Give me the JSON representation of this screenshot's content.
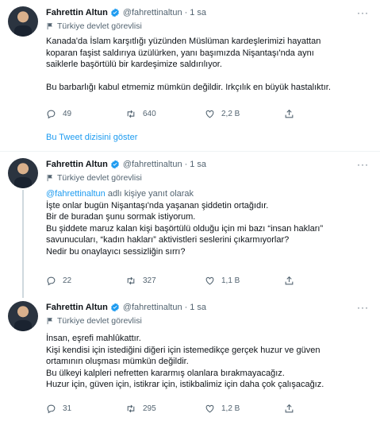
{
  "tweets": [
    {
      "name": "Fahrettin Altun",
      "handle": "@fahrettinaltun",
      "dot": "·",
      "time": "1 sa",
      "more": "···",
      "label": "Türkiye devlet görevlisi",
      "lines": [
        "Kanada'da İslam karşıtlığı yüzünden Müslüman kardeşlerimizi hayattan",
        "koparan faşist saldırıya üzülürken, yanı başımızda Nişantaşı'nda aynı",
        "saiklerle başörtülü bir kardeşimize saldırılıyor."
      ],
      "lines2": [
        "Bu barbarlığı kabul etmemiz mümkün değildir. Irkçılık en büyük hastalıktır."
      ],
      "replies": "49",
      "retweets": "640",
      "likes": "2,2 B",
      "show_thread": "Bu Tweet dizisini göster"
    },
    {
      "name": "Fahrettin Altun",
      "handle": "@fahrettinaltun",
      "dot": "·",
      "time": "1 sa",
      "more": "···",
      "label": "Türkiye devlet görevlisi",
      "replying_mention": "@fahrettinaltun",
      "replying_suffix": " adlı kişiye yanıt olarak",
      "lines": [
        "İşte onlar bugün Nişantaşı'nda yaşanan şiddetin ortağıdır.",
        "Bir de buradan şunu sormak istiyorum.",
        "Bu şiddete maruz kalan kişi başörtülü olduğu için mi bazı “insan hakları”",
        "savunucuları, “kadın hakları” aktivistleri seslerini çıkarmıyorlar?",
        "Nedir bu onaylayıcı sessizliğin sırrı?"
      ],
      "replies": "22",
      "retweets": "327",
      "likes": "1,1 B"
    },
    {
      "name": "Fahrettin Altun",
      "handle": "@fahrettinaltun",
      "dot": "·",
      "time": "1 sa",
      "more": "···",
      "label": "Türkiye devlet görevlisi",
      "lines": [
        "İnsan, eşrefi mahlûkattır.",
        "Kişi kendisi için istediğini diğeri için istemedikçe gerçek huzur ve güven",
        "ortamının oluşması mümkün değildir.",
        "Bu ülkeyi kalpleri nefretten kararmış olanlara bırakmayacağız.",
        "Huzur için, güven için, istikrar için, istikbalimiz için daha çok çalışacağız."
      ],
      "replies": "31",
      "retweets": "295",
      "likes": "1,2 B"
    }
  ],
  "icons": {
    "verified_color": "#1d9bf0",
    "label_icon": "flag-icon",
    "reply": "reply-icon",
    "retweet": "retweet-icon",
    "like": "heart-icon",
    "share": "share-icon"
  }
}
